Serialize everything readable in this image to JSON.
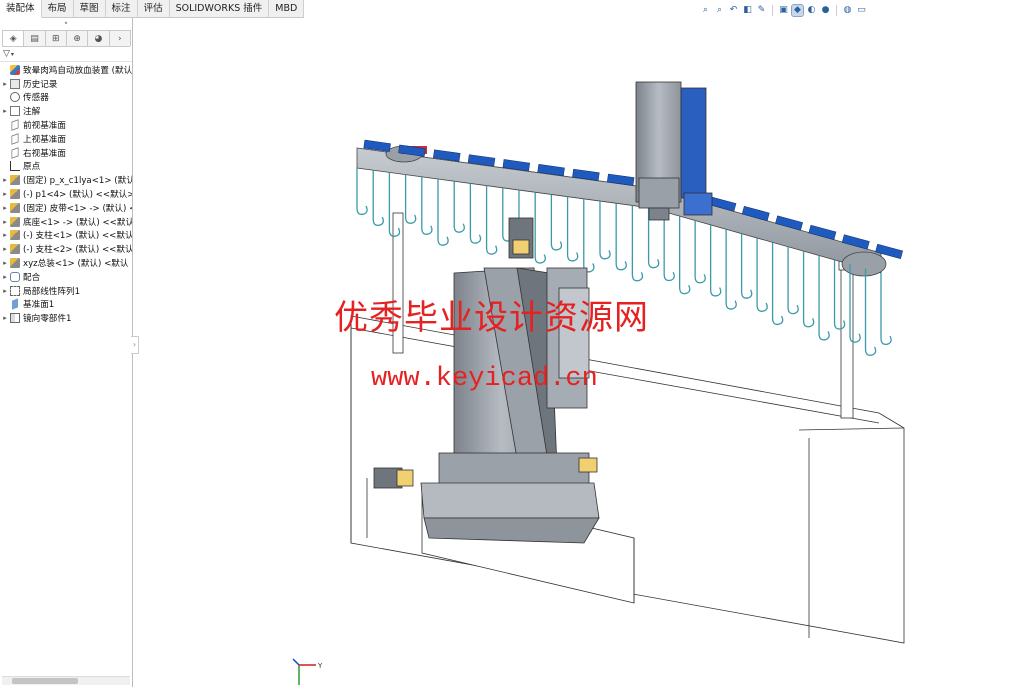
{
  "command_tabs": [
    {
      "label": "装配体",
      "active": true
    },
    {
      "label": "布局",
      "active": false
    },
    {
      "label": "草图",
      "active": false
    },
    {
      "label": "标注",
      "active": false
    },
    {
      "label": "评估",
      "active": false
    },
    {
      "label": "SOLIDWORKS 插件",
      "active": false
    },
    {
      "label": "MBD",
      "active": false
    }
  ],
  "heads_up_toolbar": [
    {
      "icon": "zoom-to-fit-icon",
      "glyph": "⌕"
    },
    {
      "icon": "zoom-area-icon",
      "glyph": "⌕"
    },
    {
      "icon": "previous-view-icon",
      "glyph": "↶"
    },
    {
      "icon": "section-view-icon",
      "glyph": "◧"
    },
    {
      "icon": "dynamic-annotation-icon",
      "glyph": "✎"
    },
    {
      "icon": "view-orientation-icon",
      "glyph": "▣"
    },
    {
      "icon": "display-style-icon",
      "glyph": "◆",
      "pressed": true
    },
    {
      "icon": "hide-show-items-icon",
      "glyph": "◐"
    },
    {
      "icon": "edit-appearance-icon",
      "glyph": "●"
    },
    {
      "icon": "apply-scene-icon",
      "glyph": "◍"
    },
    {
      "icon": "view-settings-icon",
      "glyph": "▭"
    }
  ],
  "panel_tabs": [
    {
      "icon": "feature-manager-icon",
      "glyph": "◈",
      "active": true
    },
    {
      "icon": "property-manager-icon",
      "glyph": "▤"
    },
    {
      "icon": "configuration-manager-icon",
      "glyph": "⊞"
    },
    {
      "icon": "dimxpert-manager-icon",
      "glyph": "⊕"
    },
    {
      "icon": "display-manager-icon",
      "glyph": "◕"
    },
    {
      "icon": "more-tabs-icon",
      "glyph": "›"
    }
  ],
  "filter": {
    "icon": "filter-icon",
    "glyph": "▽"
  },
  "tree": [
    {
      "label": "致晕肉鸡自动放血装置 (默认)",
      "icon": "asm",
      "arrow": ""
    },
    {
      "label": "历史记录",
      "icon": "folder",
      "arrow": "▸"
    },
    {
      "label": "传感器",
      "icon": "sensor",
      "arrow": ""
    },
    {
      "label": "注解",
      "icon": "note",
      "arrow": "▸"
    },
    {
      "label": "前视基准面",
      "icon": "plane",
      "arrow": ""
    },
    {
      "label": "上视基准面",
      "icon": "plane",
      "arrow": ""
    },
    {
      "label": "右视基准面",
      "icon": "plane",
      "arrow": ""
    },
    {
      "label": "原点",
      "icon": "origin",
      "arrow": ""
    },
    {
      "label": "(固定) p_x_c1lya<1> (默认<",
      "icon": "part",
      "arrow": "▸"
    },
    {
      "label": "(-) p1<4> (默认) <<默认>_",
      "icon": "part",
      "arrow": "▸"
    },
    {
      "label": "(固定) 皮带<1> -> (默认) <",
      "icon": "part",
      "arrow": "▸"
    },
    {
      "label": "底座<1> -> (默认) <<默认>",
      "icon": "part",
      "arrow": "▸"
    },
    {
      "label": "(-) 支柱<1> (默认) <<默认",
      "icon": "part",
      "arrow": "▸"
    },
    {
      "label": "(-) 支柱<2> (默认) <<默认",
      "icon": "part",
      "arrow": "▸"
    },
    {
      "label": "xyz总装<1> (默认) <默认",
      "icon": "part",
      "arrow": "▸"
    },
    {
      "label": "配合",
      "icon": "mate",
      "arrow": "▸"
    },
    {
      "label": "局部线性阵列1",
      "icon": "pattern",
      "arrow": "▸"
    },
    {
      "label": "基准面1",
      "icon": "plane2",
      "arrow": ""
    },
    {
      "label": "镜向零部件1",
      "icon": "mirror",
      "arrow": "▸"
    }
  ],
  "watermark": {
    "cn": "优秀毕业设计资源网",
    "url": "www.keyicad.cn"
  },
  "triad": {
    "y_label": "Y",
    "x_label": "X",
    "z_label": "Z"
  },
  "colors": {
    "watermark": "#e52222",
    "clamp_blue": "#1f5bbf",
    "hook_teal": "#3a9aa8",
    "steel_gray": "#8a8f97",
    "motor_yellow": "#f0d070"
  }
}
